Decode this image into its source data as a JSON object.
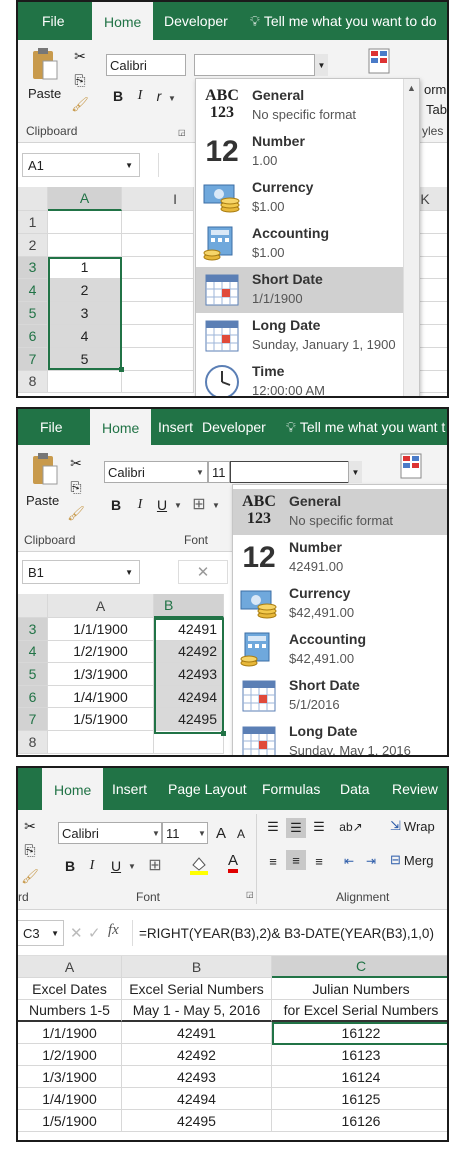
{
  "panel1": {
    "tabs": [
      "File",
      "Home",
      "Developer"
    ],
    "tell_me": "Tell me what you want to do",
    "paste_label": "Paste",
    "clipboard_label": "Clipboard",
    "font_name": "Calibri",
    "bold": "B",
    "italic": "I",
    "italic_cut": "r",
    "name_box": "A1",
    "col_headers": [
      "A",
      "I",
      "K"
    ],
    "row_headers": [
      "1",
      "2",
      "3",
      "4",
      "5",
      "6",
      "7",
      "8"
    ],
    "values": [
      "",
      "",
      "1",
      "2",
      "3",
      "4",
      "5",
      ""
    ],
    "right_label_1": "orm",
    "right_label_2": "Tabl",
    "right_label_3": "yles",
    "menu": [
      {
        "title": "General",
        "sub": "No specific format",
        "icon": "abc-123-icon"
      },
      {
        "title": "Number",
        "sub": "1.00",
        "icon": "number-12-icon"
      },
      {
        "title": "Currency",
        "sub": "$1.00",
        "icon": "currency-icon"
      },
      {
        "title": "Accounting",
        "sub": " $1.00",
        "icon": "accounting-icon"
      },
      {
        "title": "Short Date",
        "sub": "1/1/1900",
        "icon": "calendar-icon"
      },
      {
        "title": "Long Date",
        "sub": "Sunday, January 1, 1900",
        "icon": "calendar-icon"
      },
      {
        "title": "Time",
        "sub": "12:00:00 AM",
        "icon": "clock-icon"
      }
    ],
    "highlighted": 4
  },
  "panel2": {
    "tabs": [
      "File",
      "Home",
      "Insert",
      "Developer"
    ],
    "tell_me": "Tell me what you want t",
    "paste_label": "Paste",
    "clipboard_label": "Clipboard",
    "font_label": "Font",
    "font_name": "Calibri",
    "font_size": "11",
    "bold": "B",
    "italic": "I",
    "underline": "U",
    "name_box": "B1",
    "cancel_glyph": "✕",
    "col_headers": [
      "A",
      "B"
    ],
    "row_headers": [
      "3",
      "4",
      "5",
      "6",
      "7",
      "8"
    ],
    "col_a": [
      "1/1/1900",
      "1/2/1900",
      "1/3/1900",
      "1/4/1900",
      "1/5/1900",
      ""
    ],
    "col_b": [
      "42491",
      "42492",
      "42493",
      "42494",
      "42495",
      ""
    ],
    "menu": [
      {
        "title": "General",
        "sub": "No specific format",
        "icon": "abc-123-icon"
      },
      {
        "title": "Number",
        "sub": "42491.00",
        "icon": "number-12-icon"
      },
      {
        "title": "Currency",
        "sub": "$42,491.00",
        "icon": "currency-icon"
      },
      {
        "title": "Accounting",
        "sub": " $42,491.00",
        "icon": "accounting-icon"
      },
      {
        "title": "Short Date",
        "sub": "5/1/2016",
        "icon": "calendar-icon"
      },
      {
        "title": "Long Date",
        "sub": "Sunday, May 1, 2016",
        "icon": "calendar-icon"
      }
    ],
    "highlighted": 0
  },
  "panel3": {
    "tabs": [
      "Home",
      "Insert",
      "Page Layout",
      "Formulas",
      "Data",
      "Review"
    ],
    "font_name": "Calibri",
    "font_size": "11",
    "grow_font": "A",
    "shrink_font": "A",
    "bold": "B",
    "italic": "I",
    "underline": "U",
    "font_label": "Font",
    "alignment_label": "Alignment",
    "clipboard_label_cut": "rd",
    "wrap_label": "Wrap",
    "merge_label": "Merg",
    "name_box": "C3",
    "fx": "fx",
    "formula": "=RIGHT(YEAR(B3),2)& B3-DATE(YEAR(B3),1,0)",
    "col_headers": [
      "A",
      "B",
      "C"
    ],
    "header_row1": [
      "Excel Dates",
      "Excel Serial Numbers",
      "Julian Numbers"
    ],
    "header_row2": [
      "Numbers 1-5",
      "May 1 - May 5, 2016",
      "for Excel Serial Numbers"
    ],
    "rows": [
      [
        "1/1/1900",
        "42491",
        "16122"
      ],
      [
        "1/2/1900",
        "42492",
        "16123"
      ],
      [
        "1/3/1900",
        "42493",
        "16124"
      ],
      [
        "1/4/1900",
        "42494",
        "16125"
      ],
      [
        "1/5/1900",
        "42495",
        "16126"
      ]
    ]
  },
  "colors": {
    "excel_green": "#217346",
    "ribbon": "#f3f3f3",
    "highlight": "#d0d0d0"
  }
}
